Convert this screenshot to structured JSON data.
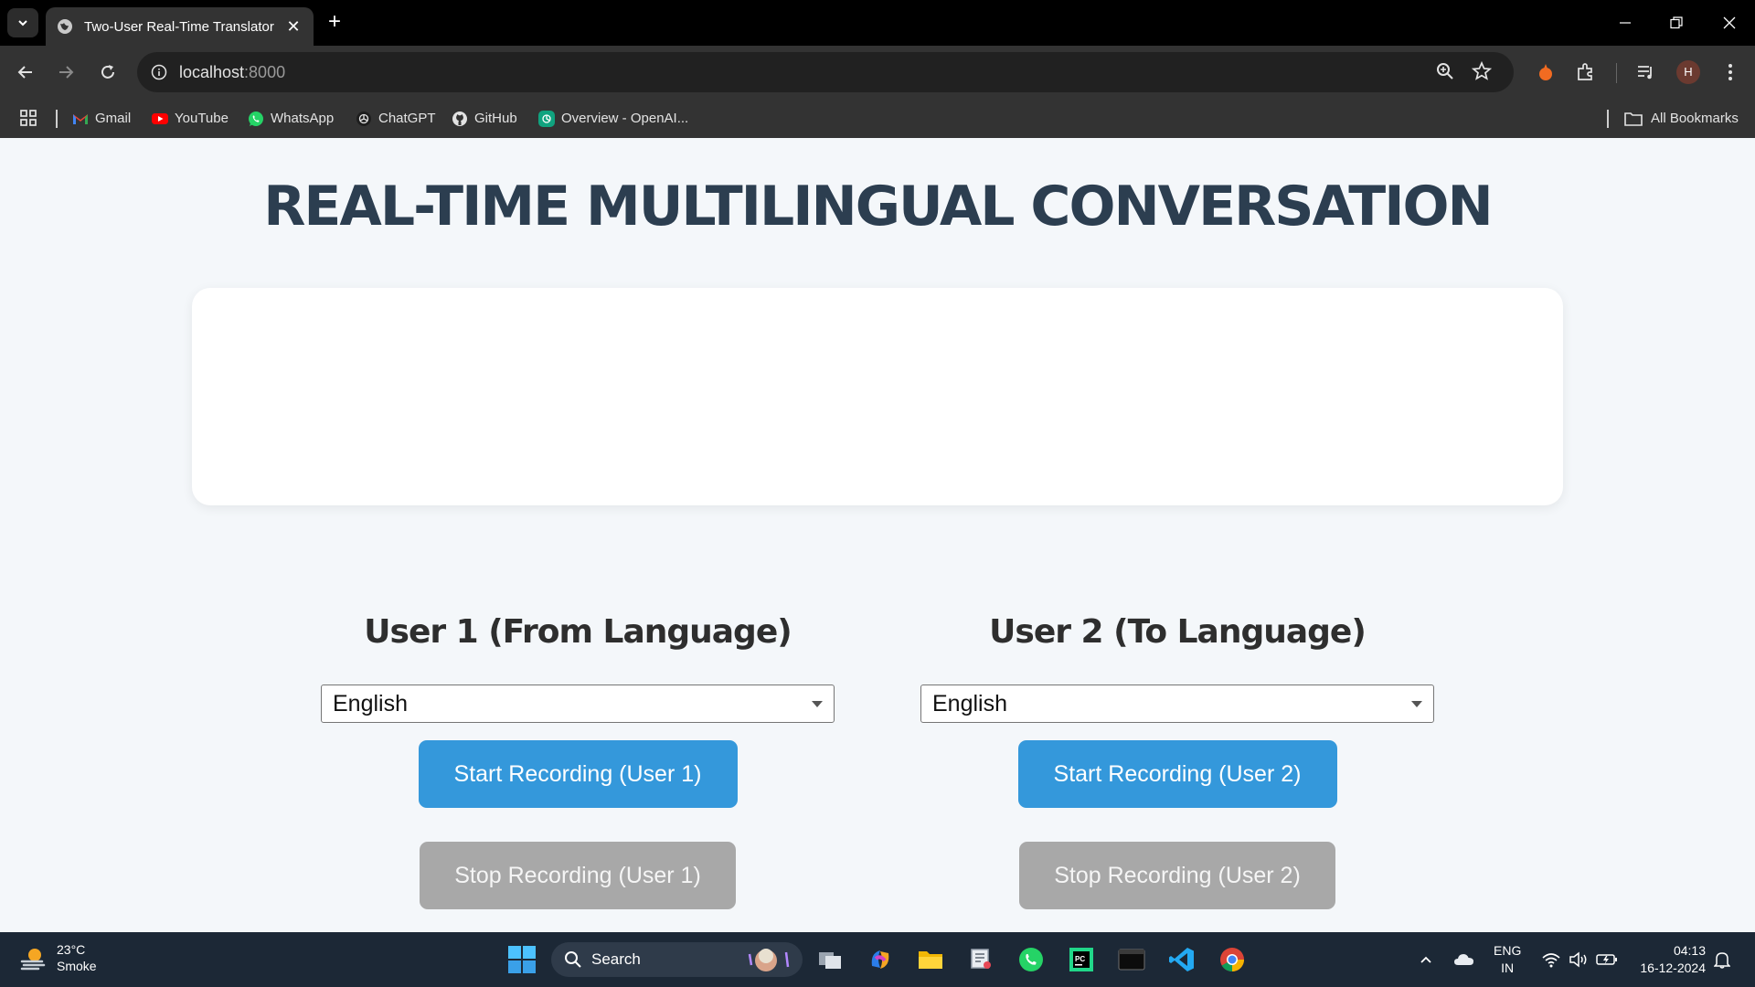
{
  "browser": {
    "tab_title": "Two-User Real-Time Translator",
    "url_host": "localhost",
    "url_port": ":8000",
    "avatar_letter": "H",
    "bookmarks": [
      "Gmail",
      "YouTube",
      "WhatsApp",
      "ChatGPT",
      "GitHub",
      "Overview - OpenAI..."
    ],
    "all_bookmarks_label": "All Bookmarks"
  },
  "page": {
    "heading": "REAL-TIME MULTILINGUAL CONVERSATION",
    "user1": {
      "title": "User 1 (From Language)",
      "language": "English",
      "start_label": "Start Recording (User 1)",
      "stop_label": "Stop Recording (User 1)"
    },
    "user2": {
      "title": "User 2 (To Language)",
      "language": "English",
      "start_label": "Start Recording (User 2)",
      "stop_label": "Stop Recording (User 2)"
    }
  },
  "taskbar": {
    "weather_temp": "23°C",
    "weather_desc": "Smoke",
    "search_placeholder": "Search",
    "lang_line1": "ENG",
    "lang_line2": "IN",
    "time": "04:13",
    "date": "16-12-2024"
  },
  "colors": {
    "heading": "#2c3e50",
    "start_button": "#3498db",
    "stop_button": "#a8a8a8",
    "page_background": "#f4f7fa"
  }
}
